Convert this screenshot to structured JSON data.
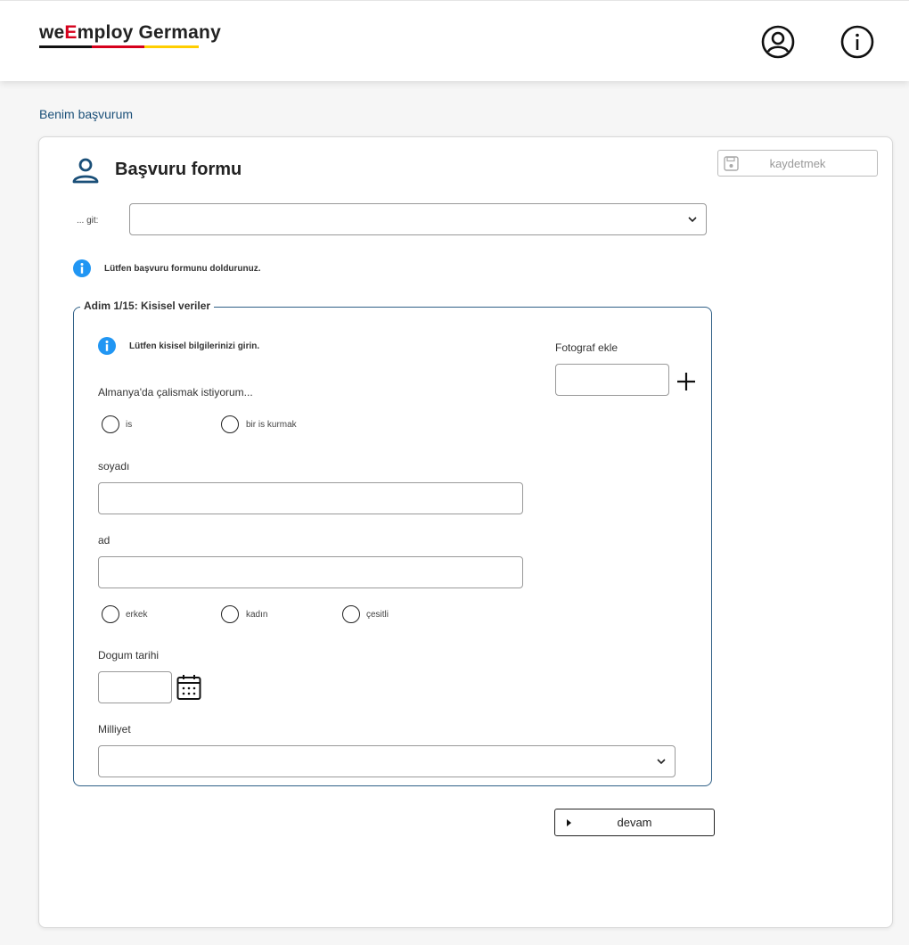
{
  "header": {
    "logo_prefix": "we",
    "logo_e": "E",
    "logo_rest": "mploy Germany",
    "icons": [
      "user-account-icon",
      "info-icon"
    ]
  },
  "breadcrumb": "Benim başvurum",
  "form": {
    "title": "Başvuru formu",
    "save_label": "kaydetmek",
    "goto_label": "... git:",
    "goto_value": "",
    "notice": "Lütfen başvuru formunu doldurunuz."
  },
  "step": {
    "legend": "Adim 1/15: Kisisel veriler",
    "notice": "Lütfen kisisel bilgilerinizi girin.",
    "photo_label": "Fotograf ekle",
    "purpose_label": "Almanya'da çalismak istiyorum...",
    "purpose_options": [
      "is",
      "bir is kurmak"
    ],
    "surname_label": "soyadı",
    "surname_value": "",
    "name_label": "ad",
    "name_value": "",
    "gender_options": [
      "erkek",
      "kadın",
      "çesitli"
    ],
    "birthdate_label": "Dogum tarihi",
    "birthdate_value": "",
    "nationality_label": "Milliyet",
    "nationality_value": ""
  },
  "next_label": "devam",
  "colors": {
    "accent": "#1a4f78",
    "info_blue": "#2196f3",
    "fieldset_border": "#2f5f86",
    "flag_black": "#111111",
    "flag_red": "#d6001c",
    "flag_gold": "#ffce00"
  }
}
